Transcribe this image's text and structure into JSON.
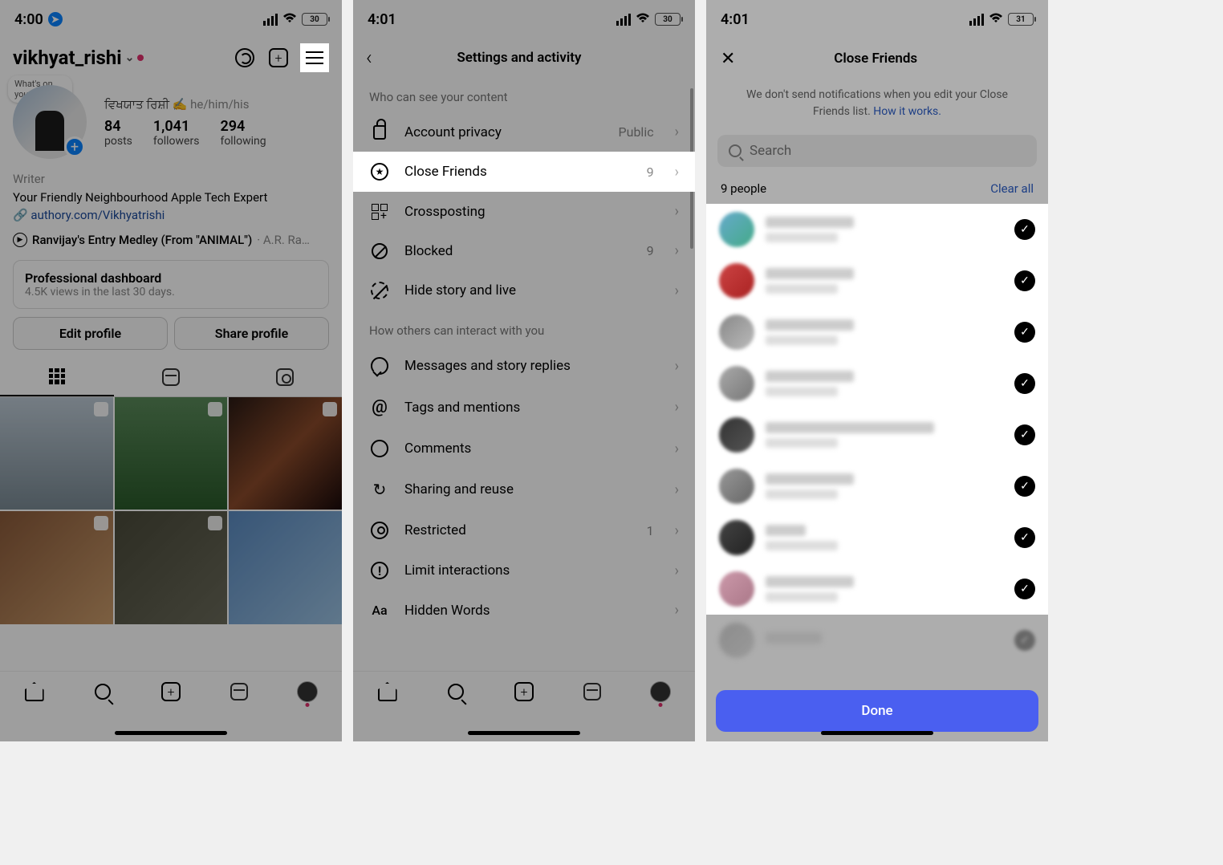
{
  "phone1": {
    "status": {
      "time": "4:00",
      "battery": "30"
    },
    "username": "vikhyat_rishi",
    "note": "What's on your playli…",
    "display_name": "ਵਿਖਯਾਤ ਰਿਸ਼ੀ ✍️",
    "pronouns": "he/him/his",
    "stats": {
      "posts": {
        "n": "84",
        "l": "posts"
      },
      "followers": {
        "n": "1,041",
        "l": "followers"
      },
      "following": {
        "n": "294",
        "l": "following"
      }
    },
    "bio": {
      "category": "Writer",
      "line": "Your Friendly Neighbourhood Apple Tech Expert",
      "link": "authory.com/Vikhyatrishi"
    },
    "music": {
      "title": "Ranvijay's Entry Medley (From \"ANIMAL\")",
      "artist": "· A.R. Ra…"
    },
    "dashboard": {
      "title": "Professional dashboard",
      "sub": "4.5K views in the last 30 days."
    },
    "buttons": {
      "edit": "Edit profile",
      "share": "Share profile"
    }
  },
  "phone2": {
    "status": {
      "time": "4:01",
      "battery": "30"
    },
    "title": "Settings and activity",
    "section1": "Who can see your content",
    "section2": "How others can interact with you",
    "rows": {
      "account_privacy": {
        "label": "Account privacy",
        "value": "Public"
      },
      "close_friends": {
        "label": "Close Friends",
        "value": "9"
      },
      "crossposting": {
        "label": "Crossposting"
      },
      "blocked": {
        "label": "Blocked",
        "value": "9"
      },
      "hide": {
        "label": "Hide story and live"
      },
      "messages": {
        "label": "Messages and story replies"
      },
      "tags": {
        "label": "Tags and mentions"
      },
      "comments": {
        "label": "Comments"
      },
      "sharing": {
        "label": "Sharing and reuse"
      },
      "restricted": {
        "label": "Restricted",
        "value": "1"
      },
      "limit": {
        "label": "Limit interactions"
      },
      "hidden_words": {
        "label": "Hidden Words"
      }
    }
  },
  "phone3": {
    "status": {
      "time": "4:01",
      "battery": "31"
    },
    "title": "Close Friends",
    "info": "We don't send notifications when you edit your Close Friends list.",
    "info_link": "How it works.",
    "search_placeholder": "Search",
    "count": "9 people",
    "clear": "Clear all",
    "done": "Done"
  }
}
